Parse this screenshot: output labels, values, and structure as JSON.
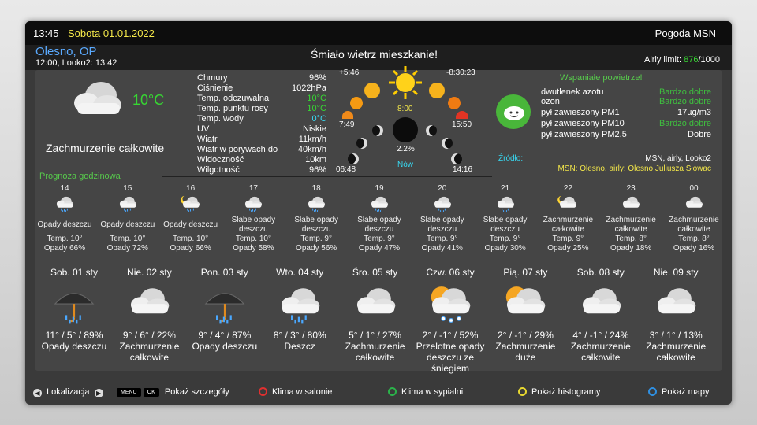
{
  "topbar": {
    "time": "13:45",
    "date": "Sobota 01.01.2022",
    "app_title": "Pogoda MSN"
  },
  "header": {
    "location": "Olesno, OP",
    "update_info": "12:00, Looko2: 13:42",
    "message": "Śmiało wietrz mieszkanie!",
    "airly_label": "Airly limit:",
    "airly_used": "876",
    "airly_total": "/1000"
  },
  "current": {
    "temp": "10°C",
    "condition": "Zachmurzenie całkowite",
    "details": [
      {
        "k": "Chmury",
        "v": "96%",
        "color": "#ffffff"
      },
      {
        "k": "Ciśnienie",
        "v": "1022hPa",
        "color": "#ffffff"
      },
      {
        "k": "Temp. odczuwalna",
        "v": "10°C",
        "color": "#37d633"
      },
      {
        "k": "Temp. punktu rosy",
        "v": "10°C",
        "color": "#37d633"
      },
      {
        "k": "Temp. wody",
        "v": "0°C",
        "color": "#38d9f2"
      },
      {
        "k": "UV",
        "v": "Niskie",
        "color": "#ffffff"
      },
      {
        "k": "Wiatr",
        "v": "11km/h",
        "color": "#ffffff"
      },
      {
        "k": "Wiatr w porywach do",
        "v": "40km/h",
        "color": "#ffffff"
      },
      {
        "k": "Widoczność",
        "v": "10km",
        "color": "#ffffff"
      },
      {
        "k": "Wilgotność",
        "v": "96%",
        "color": "#ffffff"
      }
    ]
  },
  "astro": {
    "day_diff": "+5:46",
    "night_diff": "-8:30:23",
    "noon": "8:00",
    "sunrise": "7:49",
    "sunset": "15:50",
    "moonrise": "06:48",
    "moonset": "14:16",
    "moon_illum": "2.2%",
    "moon_phase": "Nów"
  },
  "air": {
    "headline": "Wspaniałe powietrze!",
    "rows": [
      {
        "k": "dwutlenek azotu",
        "v": "Bardzo dobre",
        "color": "#3fbf3f"
      },
      {
        "k": "ozon",
        "v": "Bardzo dobre",
        "color": "#3fbf3f"
      },
      {
        "k": "pył zawieszony PM1",
        "v": "17µg/m3",
        "color": "#ffffff"
      },
      {
        "k": "pył zawieszony PM10",
        "v": "Bardzo dobre",
        "color": "#3fbf3f"
      },
      {
        "k": "pył zawieszony PM2.5",
        "v": "Dobre",
        "color": "#ffffff"
      }
    ],
    "source_label": "Źródło:",
    "source": "MSN, airly, Looko2",
    "source_detail": "MSN: Olesno, airly: Olesno Juliusza Słowac"
  },
  "hourly_title": "Prognoza godzinowa",
  "hourly": [
    {
      "hour": "14",
      "icon": "cloud-rain-icon",
      "desc": "Opady deszczu",
      "temp": "Temp. 10°",
      "prec": "Opady 66%"
    },
    {
      "hour": "15",
      "icon": "cloud-rain-icon",
      "desc": "Opady deszczu",
      "temp": "Temp. 10°",
      "prec": "Opady 72%"
    },
    {
      "hour": "16",
      "icon": "moon-cloud-rain-icon",
      "desc": "Opady deszczu",
      "temp": "Temp. 10°",
      "prec": "Opady 66%"
    },
    {
      "hour": "17",
      "icon": "cloud-rain-icon",
      "desc": "Słabe opady deszczu",
      "temp": "Temp. 10°",
      "prec": "Opady 58%"
    },
    {
      "hour": "18",
      "icon": "cloud-rain-icon",
      "desc": "Słabe opady deszczu",
      "temp": "Temp. 9°",
      "prec": "Opady 56%"
    },
    {
      "hour": "19",
      "icon": "cloud-rain-icon",
      "desc": "Słabe opady deszczu",
      "temp": "Temp. 9°",
      "prec": "Opady 47%"
    },
    {
      "hour": "20",
      "icon": "cloud-rain-icon",
      "desc": "Słabe opady deszczu",
      "temp": "Temp. 9°",
      "prec": "Opady 41%"
    },
    {
      "hour": "21",
      "icon": "cloud-rain-icon",
      "desc": "Słabe opady deszczu",
      "temp": "Temp. 9°",
      "prec": "Opady 30%"
    },
    {
      "hour": "22",
      "icon": "moon-cloud-icon",
      "desc": "Zachmurzenie całkowite",
      "temp": "Temp. 9°",
      "prec": "Opady 25%"
    },
    {
      "hour": "23",
      "icon": "cloud-icon",
      "desc": "Zachmurzenie całkowite",
      "temp": "Temp. 8°",
      "prec": "Opady 18%"
    },
    {
      "hour": "00",
      "icon": "cloud-icon",
      "desc": "Zachmurzenie całkowite",
      "temp": "Temp. 8°",
      "prec": "Opady 16%"
    }
  ],
  "daily": [
    {
      "day": "Sob. 01 sty",
      "icon": "umbrella-rain-icon",
      "temps": "11° / 5° / 89%",
      "desc": "Opady deszczu"
    },
    {
      "day": "Nie. 02 sty",
      "icon": "cloud-icon",
      "temps": "9° / 6° / 22%",
      "desc": "Zachmurzenie całkowite"
    },
    {
      "day": "Pon. 03 sty",
      "icon": "umbrella-rain-icon",
      "temps": "9° / 4° / 87%",
      "desc": "Opady deszczu"
    },
    {
      "day": "Wto. 04 sty",
      "icon": "cloud-rain-icon",
      "temps": "8° / 3° / 80%",
      "desc": "Deszcz"
    },
    {
      "day": "Śro. 05 sty",
      "icon": "cloud-icon",
      "temps": "5° / 1° / 27%",
      "desc": "Zachmurzenie całkowite"
    },
    {
      "day": "Czw. 06 sty",
      "icon": "sun-cloud-snow-icon",
      "temps": "2° / -1° / 52%",
      "desc": "Przelotne opady deszczu ze śniegiem"
    },
    {
      "day": "Pią. 07 sty",
      "icon": "sun-cloud-icon",
      "temps": "2° / -1° / 29%",
      "desc": "Zachmurzenie duże"
    },
    {
      "day": "Sob. 08 sty",
      "icon": "cloud-icon",
      "temps": "4° / -1° / 24%",
      "desc": "Zachmurzenie całkowite"
    },
    {
      "day": "Nie. 09 sty",
      "icon": "cloud-icon",
      "temps": "3° / 1° / 13%",
      "desc": "Zachmurzenie całkowite"
    }
  ],
  "footer": {
    "location_label": "Lokalizacja",
    "menu_key": "MENU",
    "ok_key": "OK",
    "details_label": "Pokaż szczegóły",
    "red": "Klima w salonie",
    "green": "Klima w sypialni",
    "yellow": "Pokaż histogramy",
    "blue": "Pokaż mapy",
    "colors": {
      "red": "#e03030",
      "green": "#2bb34a",
      "yellow": "#e8d830",
      "blue": "#2f8fe0"
    }
  }
}
